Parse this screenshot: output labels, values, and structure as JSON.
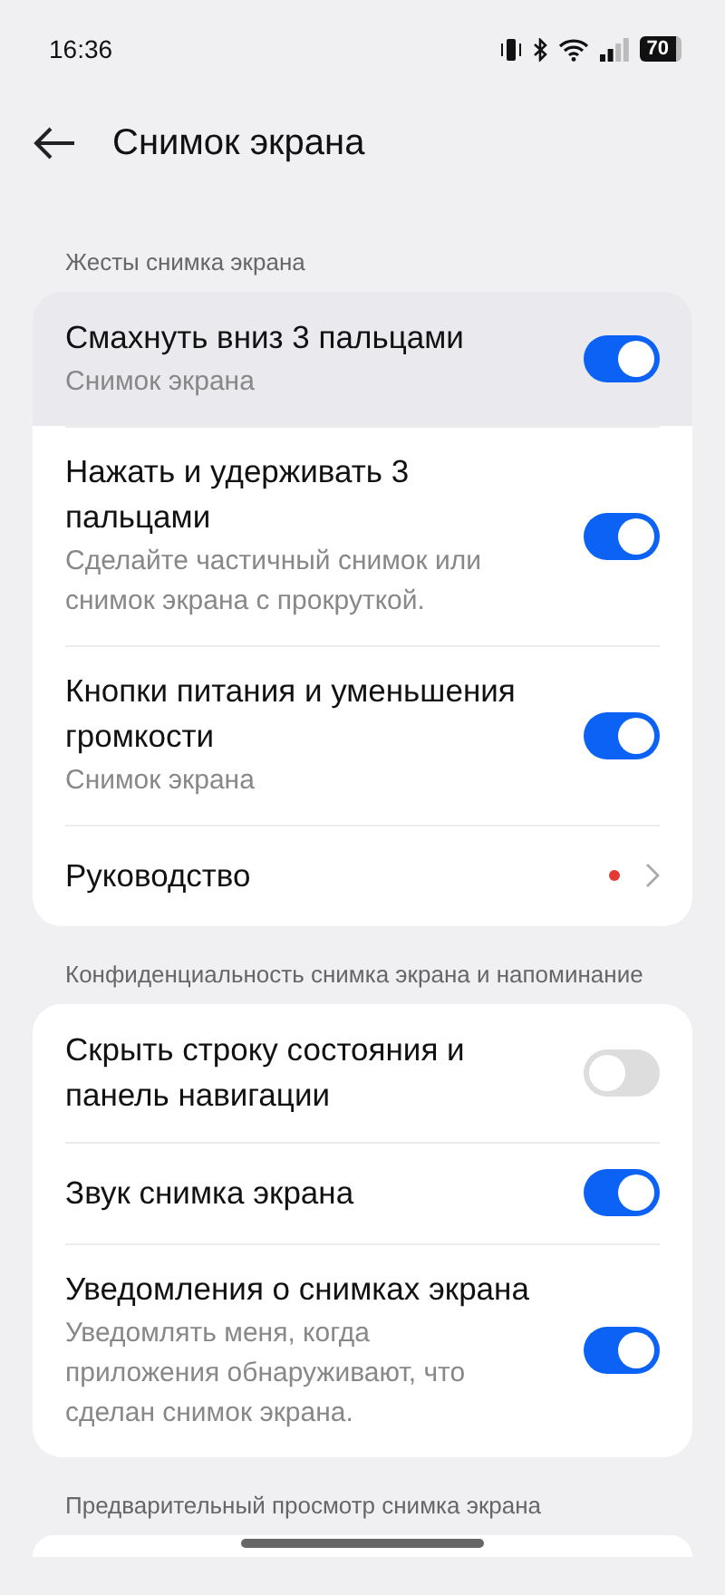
{
  "status_bar": {
    "time": "16:36",
    "battery": "70"
  },
  "header": {
    "title": "Снимок экрана"
  },
  "sections": [
    {
      "title": "Жесты снимка экрана",
      "items": [
        {
          "kind": "toggle",
          "title": "Смахнуть вниз 3 пальцами",
          "subtitle": "Снимок экрана",
          "on": true,
          "highlighted": true
        },
        {
          "kind": "toggle",
          "title": "Нажать и удерживать 3 пальцами",
          "subtitle": "Сделайте частичный снимок или снимок экрана с прокруткой.",
          "on": true,
          "highlighted": false
        },
        {
          "kind": "toggle",
          "title": "Кнопки питания и уменьшения громкости",
          "subtitle": "Снимок экрана",
          "on": true,
          "highlighted": false
        },
        {
          "kind": "link",
          "title": "Руководство",
          "badge": true,
          "color": "#e53935",
          "highlighted": false
        }
      ]
    },
    {
      "title": "Конфиденциальность снимка экрана и напоминание",
      "items": [
        {
          "kind": "toggle",
          "title": "Скрыть строку состояния и панель навигации",
          "on": false,
          "highlighted": false
        },
        {
          "kind": "toggle",
          "title": "Звук снимка экрана",
          "on": true,
          "highlighted": false
        },
        {
          "kind": "toggle",
          "title": "Уведомления о снимках экрана",
          "subtitle": "Уведомлять меня, когда приложения обнаруживают, что сделан снимок экрана.",
          "on": true,
          "highlighted": false
        }
      ]
    },
    {
      "title": "Предварительный просмотр снимка экрана"
    }
  ]
}
